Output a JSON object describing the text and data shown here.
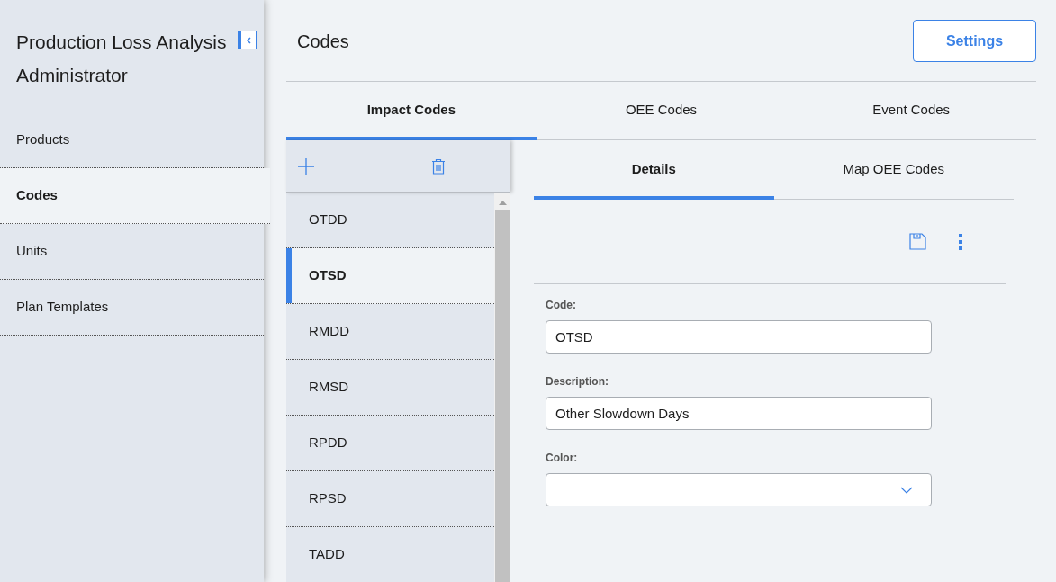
{
  "sidebar": {
    "title": "Production Loss Analysis Administrator",
    "items": [
      {
        "label": "Products",
        "selected": false
      },
      {
        "label": "Codes",
        "selected": true
      },
      {
        "label": "Units",
        "selected": false
      },
      {
        "label": "Plan Templates",
        "selected": false
      }
    ]
  },
  "header": {
    "title": "Codes",
    "settings_button": "Settings"
  },
  "tabs": [
    {
      "label": "Impact Codes",
      "selected": true
    },
    {
      "label": "OEE Codes",
      "selected": false
    },
    {
      "label": "Event Codes",
      "selected": false
    }
  ],
  "code_list": [
    {
      "label": "OTDD",
      "selected": false
    },
    {
      "label": "OTSD",
      "selected": true
    },
    {
      "label": "RMDD",
      "selected": false
    },
    {
      "label": "RMSD",
      "selected": false
    },
    {
      "label": "RPDD",
      "selected": false
    },
    {
      "label": "RPSD",
      "selected": false
    },
    {
      "label": "TADD",
      "selected": false
    }
  ],
  "detail_tabs": [
    {
      "label": "Details",
      "selected": true
    },
    {
      "label": "Map OEE Codes",
      "selected": false
    }
  ],
  "form": [
    {
      "kind": "text",
      "label": "Code:",
      "value": "OTSD"
    },
    {
      "kind": "text",
      "label": "Description:",
      "value": "Other Slowdown Days"
    },
    {
      "kind": "select",
      "label": "Color:"
    }
  ]
}
